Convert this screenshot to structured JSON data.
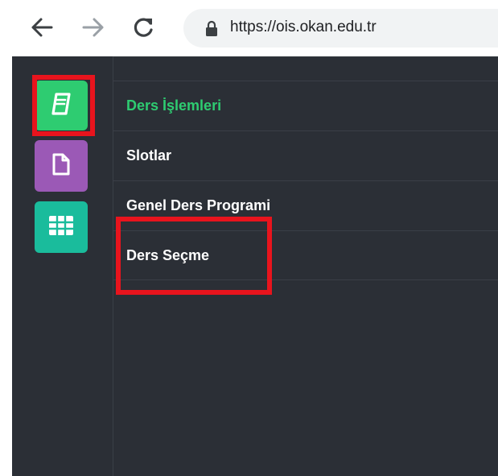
{
  "browser": {
    "url": "https://ois.okan.edu.tr",
    "icons": [
      "back-arrow-icon",
      "forward-arrow-icon",
      "reload-icon",
      "lock-icon"
    ]
  },
  "rail": {
    "buttons": [
      {
        "name": "course-book-button",
        "icon": "book-icon",
        "color": "#2ecc71"
      },
      {
        "name": "document-button",
        "icon": "file-icon",
        "color": "#9b59b6"
      },
      {
        "name": "schedule-grid-button",
        "icon": "grid-icon",
        "color": "#1abc9c"
      }
    ]
  },
  "menu": {
    "items": [
      {
        "label": "Ders İşlemleri",
        "active": true
      },
      {
        "label": "Slotlar"
      },
      {
        "label": "Genel Ders Programi"
      },
      {
        "label": "Ders Seçme"
      }
    ]
  },
  "colors": {
    "highlight": "#e8141d",
    "active_text": "#2ecc71",
    "panel_bg": "#2b2f36"
  }
}
